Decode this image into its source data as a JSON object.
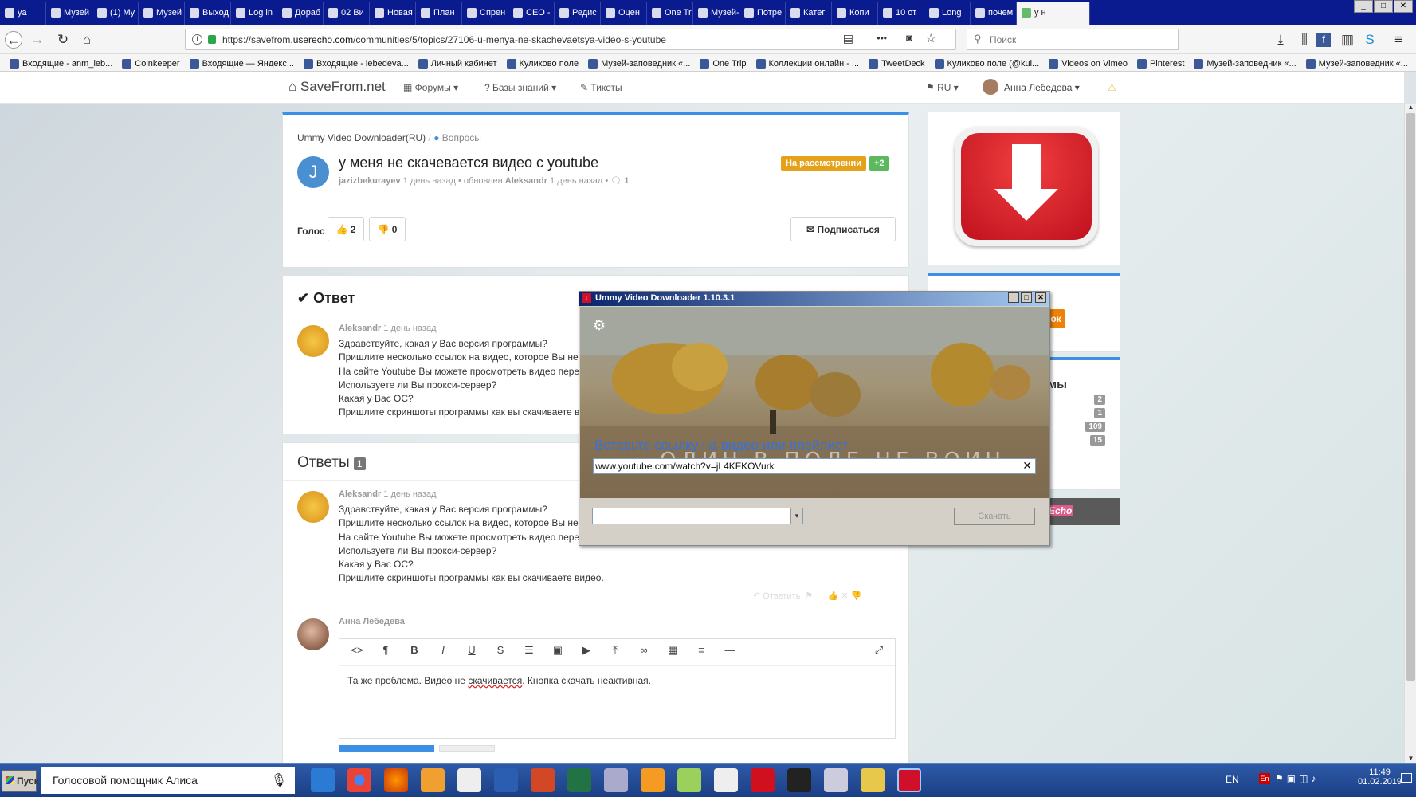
{
  "browser": {
    "tabs": [
      "ya",
      "Музей",
      "(1) My",
      "Музей",
      "Выход",
      "Log in",
      "Дораб",
      "02 Ви",
      "Новая",
      "План",
      "Спрен",
      "CEO -",
      "Редис",
      "Оцен",
      "One Trip",
      "Музей-запо",
      "Потре",
      "Катег",
      "Копи",
      "10 от",
      "Long",
      "почем",
      "у н"
    ],
    "url_prefix": "https://savefrom.",
    "url_domain": "userecho.com",
    "url_rest": "/communities/5/topics/27106-u-menya-ne-skachevaetsya-video-s-youtube",
    "search_placeholder": "Поиск",
    "menu_dots": "•••",
    "bookmarks": [
      "Входящие - anm_leb...",
      "Coinkeeper",
      "Входящие — Яндекс...",
      "Входящие - lebedeva...",
      "Личный кабинет",
      "Куликово поле",
      "Музей-заповедник «...",
      "One Trip",
      "Коллекции онлайн - ...",
      "TweetDeck",
      "Куликово поле (@kul...",
      "Videos on Vimeo",
      "Pinterest",
      "Музей-заповедник «...",
      "Музей-заповедник «..."
    ],
    "accent": "#0a1a8f"
  },
  "site": {
    "logo": "SaveFrom.net",
    "menu": {
      "forums": "Форумы",
      "knowledge": "Базы знаний",
      "tickets": "Тикеты"
    },
    "lang": "RU",
    "user": "Анна Лебедева"
  },
  "topic": {
    "breadcrumb_1": "Ummy Video Downloader(RU)",
    "breadcrumb_2": "Вопросы",
    "avatar_letter": "J",
    "title": "у меня не скачевается видео с youtube",
    "author": "jazizbekurayev",
    "meta_1": "1 день назад • обновлен",
    "updater": "Aleksandr",
    "meta_2": "1 день назад •",
    "comments": "1",
    "status_badge": "На рассмотрении",
    "score_badge": "+2",
    "vote_label": "Голос",
    "up_count": "2",
    "down_count": "0",
    "subscribe": "Подписаться"
  },
  "answer": {
    "heading": "Ответ",
    "author": "Aleksandr",
    "time": "1 день назад",
    "lines": [
      "Здравствуйте, какая у Вас версия программы?",
      "Пришлите несколько ссылок на видео, которое Вы не",
      "На сайте Youtube Вы можете просмотреть видео перед",
      "Используете ли Вы прокси-сервер?",
      "Какая у Вас ОС?",
      "Пришлите скриншоты программы как вы скачиваете в"
    ]
  },
  "replies": {
    "heading": "Ответы",
    "count": "1",
    "author": "Aleksandr",
    "time": "1 день назад",
    "lines": [
      "Здравствуйте, какая у Вас версия программы?",
      "Пришлите несколько ссылок на видео, которое Вы не",
      "На сайте Youtube Вы можете просмотреть видео перед тем как скачать?",
      "Используете ли Вы прокси-сервер?",
      "Какая у Вас ОС?",
      "Пришлите скриншоты программы как вы скачиваете видео."
    ],
    "reply_link": "Ответить"
  },
  "editor": {
    "author": "Анна Лебедева",
    "text_1": "Та же проблема. Видео не ",
    "text_misspelled": "скачивается",
    "text_2": ". Кнопка скачать неактивная."
  },
  "sidebar": {
    "stats": [
      "2",
      "1",
      "109",
      "15"
    ],
    "partial_heading": "мы",
    "echo_label": "Echo"
  },
  "dialog": {
    "title": "Ummy Video Downloader 1.10.3.1",
    "prompt": "Вставьте ссылку на видео или плейлист",
    "watermark": "ОДИН В ПОЛЕ НЕ ВОИН",
    "url_value": "www.youtube.com/watch?v=jL4KFKOVurk",
    "download_button": "Скачать"
  },
  "taskbar": {
    "start": "Пуск",
    "assistant": "Голосовой помощник Алиса",
    "lang": "EN",
    "time": "11:49",
    "date": "01.02.2019"
  }
}
